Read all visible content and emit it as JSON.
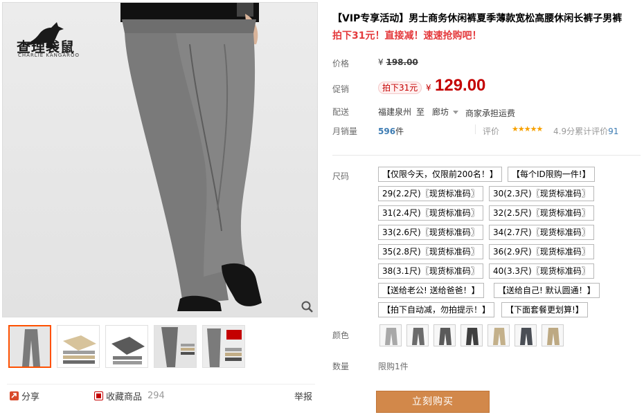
{
  "gallery": {
    "brand_cn": "查理袋鼠",
    "brand_en": "CHARLIE KANGAROO",
    "thumbnail_count": 5
  },
  "actions": {
    "share": "分享",
    "favorite": "收藏商品",
    "favorite_count": "294",
    "report": "举报"
  },
  "product": {
    "title": "【VIP专享活动】男士商务休闲裤夏季薄款宽松高腰休闲长裤子男裤",
    "subtitle": "拍下31元！直接减！速速抢购吧！"
  },
  "price": {
    "label": "价格",
    "yen": "¥",
    "original": "198.00"
  },
  "promo": {
    "label": "促销",
    "tag": "拍下31元",
    "yen": "¥",
    "price": "129.00"
  },
  "shipping": {
    "label": "配送",
    "from": "福建泉州",
    "to_word": "至",
    "to": "廊坊",
    "fee": "商家承担运费"
  },
  "sales": {
    "label": "月销量",
    "count": "596",
    "unit": "件",
    "rating_label": "评价",
    "stars": "★★★★★",
    "score": "4.9分累计评价",
    "review_count": "91"
  },
  "size": {
    "label": "尺码",
    "options": [
      "【仅限今天，仅限前200名！】",
      "【每个ID限购一件!】",
      "29(2.2尺)〖现货标准码〗",
      "30(2.3尺)〖现货标准码〗",
      "31(2.4尺)〖现货标准码〗",
      "32(2.5尺)〖现货标准码〗",
      "33(2.6尺)〖现货标准码〗",
      "34(2.7尺)〖现货标准码〗",
      "35(2.8尺)〖现货标准码〗",
      "36(2.9尺)〖现货标准码〗",
      "38(3.1尺)〖现货标准码〗",
      "40(3.3尺)〖现货标准码〗",
      "【送给老公! 送给爸爸！】",
      "【送给自己! 默认圆通！】",
      "【拍下自动减，勿拍提示！】",
      "【下面套餐更划算!】"
    ]
  },
  "color": {
    "label": "颜色",
    "swatch_colors": [
      "#a8a8a8",
      "#6b6b6b",
      "#5a5a5a",
      "#3f3f3f",
      "#c3b08a",
      "#4a4e55",
      "#bda983"
    ]
  },
  "quantity": {
    "label": "数量",
    "limit": "限购1件"
  },
  "buy_button": "立刻购买"
}
